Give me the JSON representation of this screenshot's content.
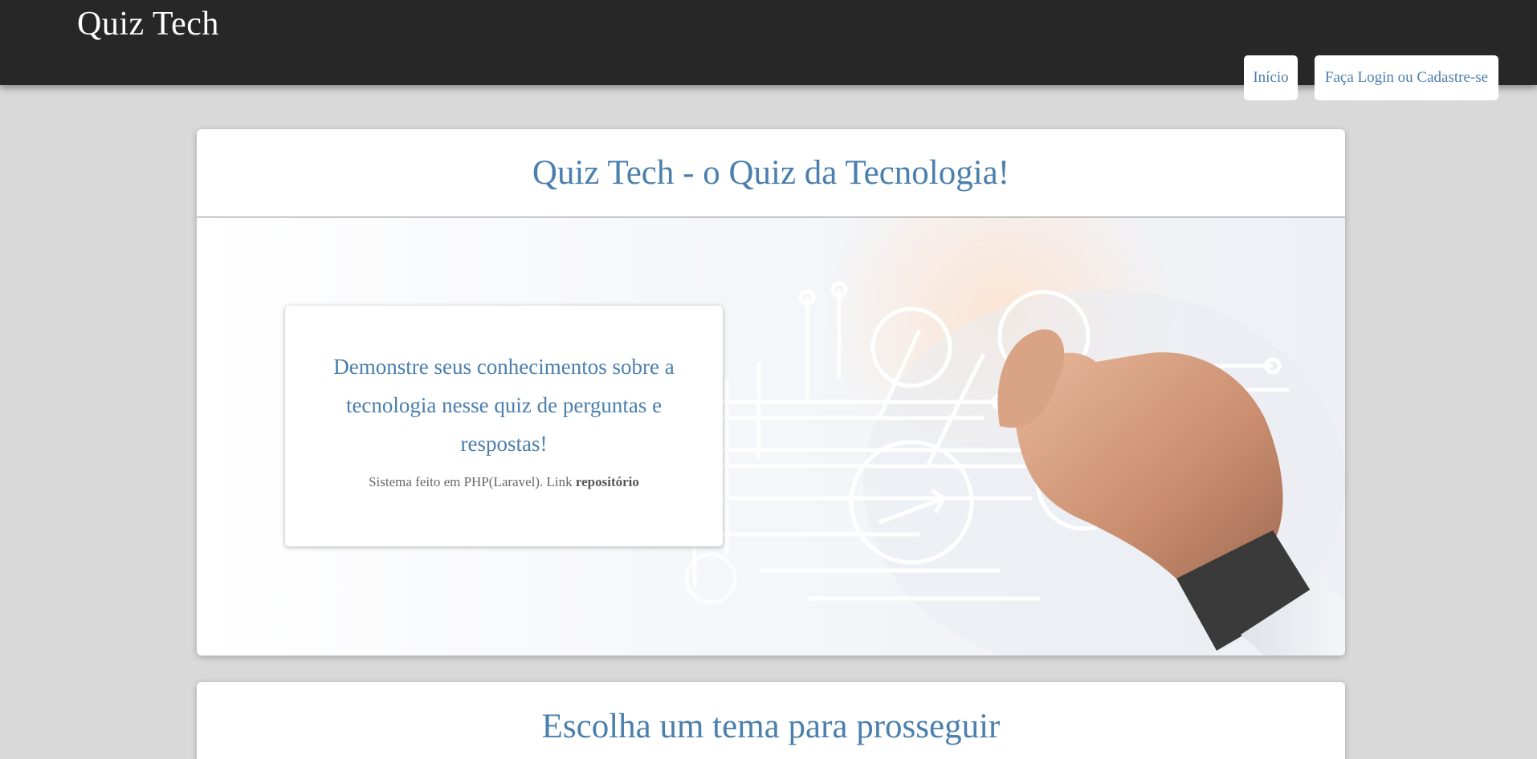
{
  "header": {
    "brand": "Quiz Tech",
    "nav": {
      "home_label": "Início",
      "login_label": "Faça Login ou Cadastre-se"
    }
  },
  "hero": {
    "title": "Quiz Tech - o Quiz da Tecnologia!",
    "headline": "Demonstre seus conhecimentos sobre a tecnologia nesse quiz de perguntas e respostas!",
    "subtext": "Sistema feito em PHP(Laravel). Link",
    "repo_link": "repositório",
    "image_icon": "tech-hand-circuit-illustration"
  },
  "themes": {
    "title": "Escolha um tema para prosseguir"
  },
  "colors": {
    "topbar": "#272727",
    "accent": "#4a7fae",
    "background": "#d9d9d9"
  }
}
